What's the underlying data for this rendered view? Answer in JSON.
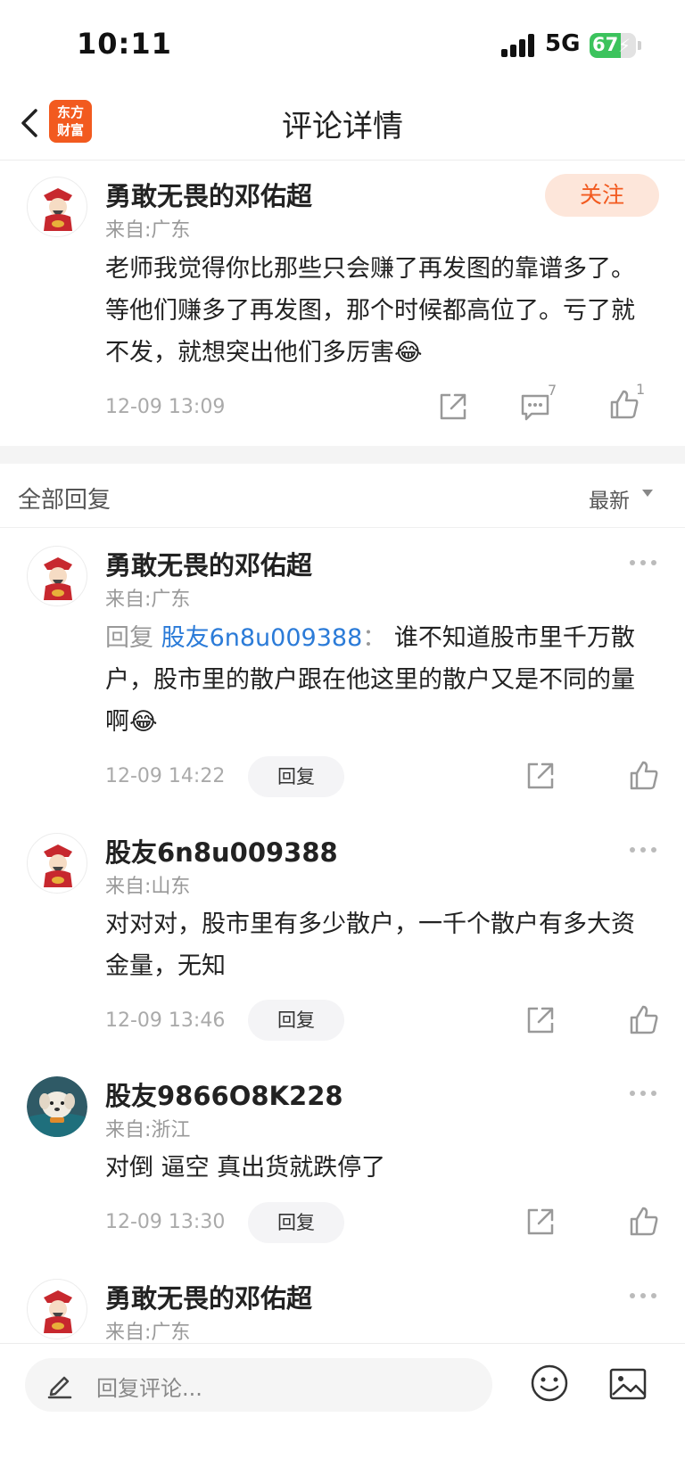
{
  "status_bar": {
    "time": "10:11",
    "network": "5G",
    "battery": "67",
    "battery_level_percent": 67
  },
  "nav": {
    "title": "评论详情",
    "logo_line1": "东方",
    "logo_line2": "财富"
  },
  "main_comment": {
    "user": "勇敢无畏的邓佑超",
    "location": "来自:广东",
    "follow_label": "关注",
    "text": "老师我觉得你比那些只会赚了再发图的靠谱多了。等他们赚多了再发图，那个时候都高位了。亏了就不发，就想突出他们多厉害😂",
    "time": "12-09 13:09",
    "comment_count": "7",
    "like_count": "1"
  },
  "replies_header": {
    "label": "全部回复",
    "sort": "最新"
  },
  "replies": [
    {
      "user": "勇敢无畏的邓佑超",
      "location": "来自:广东",
      "reply_prefix": "回复",
      "reply_target": "股友6n8u009388",
      "reply_colon": "：",
      "text": "谁不知道股市里千万散户，股市里的散户跟在他这里的散户又是不同的量啊😂",
      "time": "12-09 14:22",
      "reply_label": "回复"
    },
    {
      "user": "股友6n8u009388",
      "location": "来自:山东",
      "text": "对对对，股市里有多少散户，一千个散户有多大资金量，无知",
      "time": "12-09 13:46",
      "reply_label": "回复"
    },
    {
      "user": "股友9866O8K228",
      "location": "来自:浙江",
      "text": "对倒 逼空  真出货就跌停了",
      "time": "12-09 13:30",
      "reply_label": "回复"
    },
    {
      "user": "勇敢无畏的邓佑超",
      "location": "来自:广东"
    }
  ],
  "bottom_bar": {
    "placeholder": "回复评论..."
  },
  "colors": {
    "accent": "#f25a1f",
    "link": "#2b7bd8",
    "battery": "#3cc35d"
  }
}
